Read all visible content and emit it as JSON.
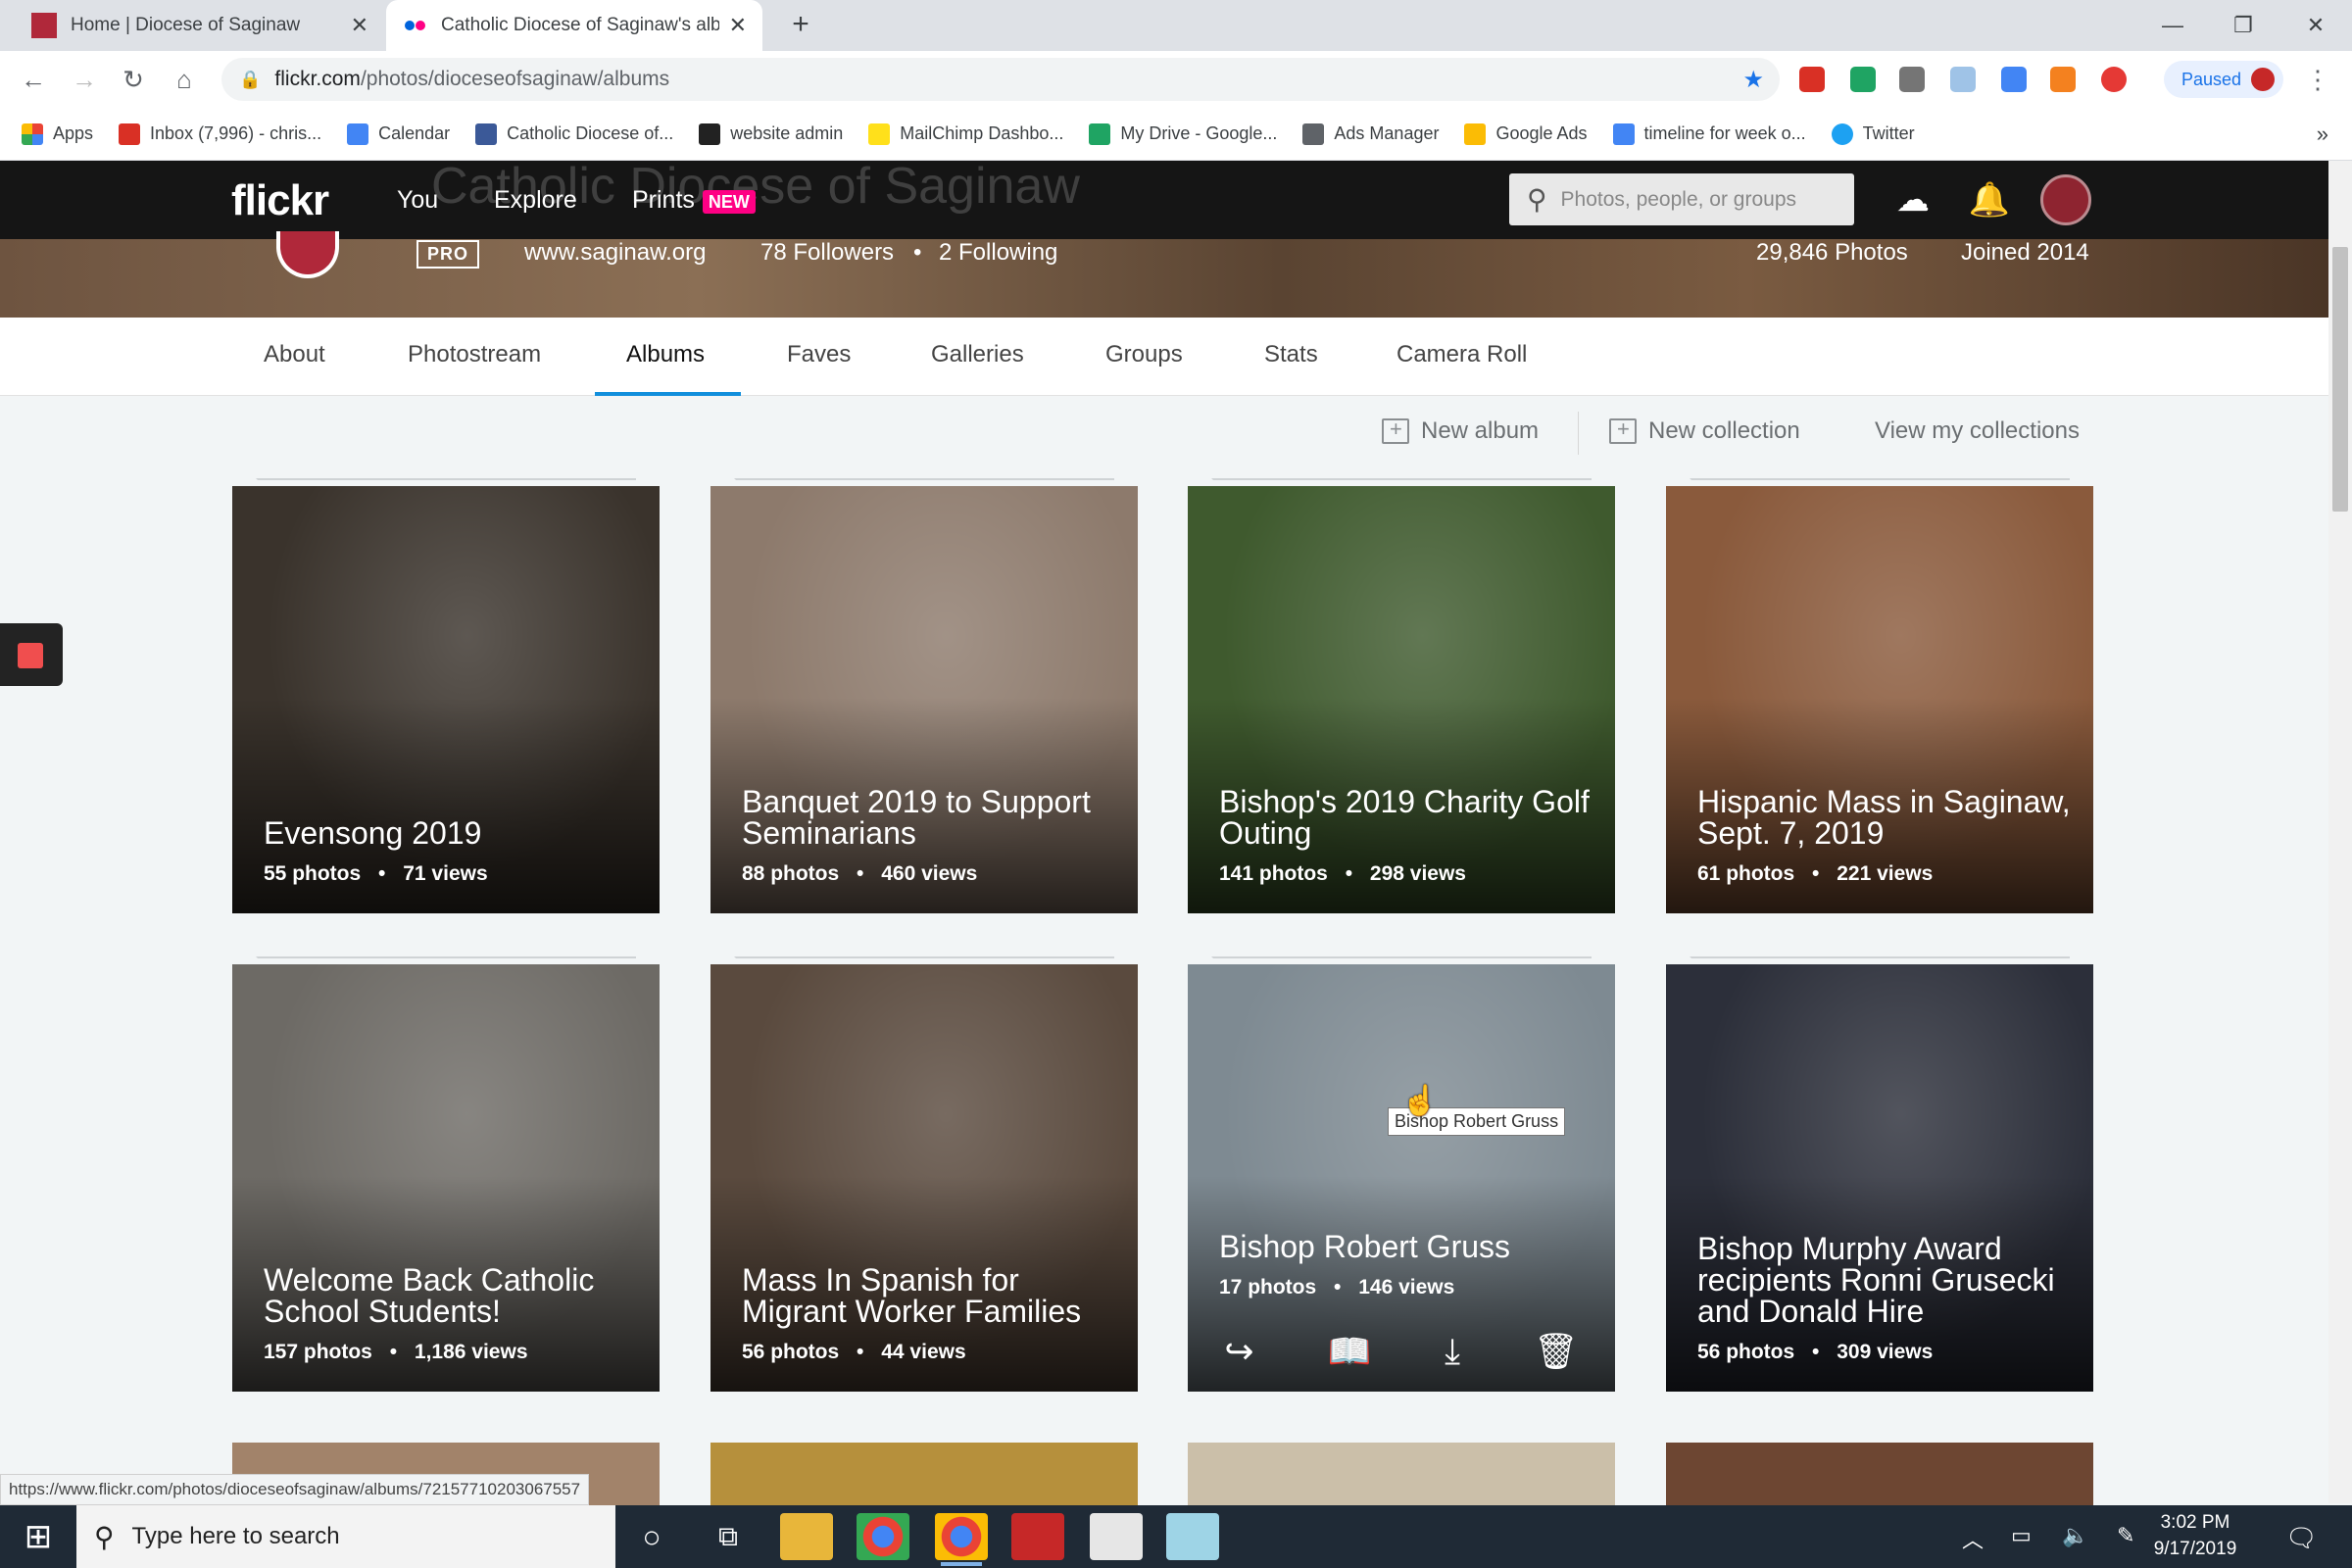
{
  "browser": {
    "tabs": [
      {
        "title": "Home | Diocese of Saginaw",
        "active": false
      },
      {
        "title": "Catholic Diocese of Saginaw's albums",
        "active": true
      }
    ],
    "new_tab": "+",
    "url_host": "flickr.com",
    "url_path": "/photos/dioceseofsaginaw/albums",
    "paused_label": "Paused",
    "bookmarks": [
      "Apps",
      "Inbox (7,996) - chris...",
      "Calendar",
      "Catholic Diocese of...",
      "website admin",
      "MailChimp Dashbo...",
      "My Drive - Google...",
      "Ads Manager",
      "Google Ads",
      "timeline for week o...",
      "Twitter"
    ],
    "more": "»"
  },
  "flickr": {
    "logo": "flickr",
    "nav": {
      "you": "You",
      "explore": "Explore",
      "prints": "Prints",
      "new_badge": "NEW"
    },
    "search_placeholder": "Photos, people, or groups",
    "cover_title": "Catholic Diocese of Saginaw",
    "pro": "PRO",
    "website": "www.saginaw.org",
    "followers": "78 Followers",
    "following": "2 Following",
    "dot": "•",
    "photos_count": "29,846 Photos",
    "joined": "Joined 2014",
    "subnav": [
      "About",
      "Photostream",
      "Albums",
      "Faves",
      "Galleries",
      "Groups",
      "Stats",
      "Camera Roll"
    ],
    "selected_subnav": "Albums",
    "actions": {
      "new_album": "New album",
      "new_collection": "New collection",
      "view_collections": "View my collections"
    },
    "albums": [
      {
        "title": "Evensong 2019",
        "photos": "55 photos",
        "views": "71 views",
        "bg": "#3a332c"
      },
      {
        "title": "Banquet 2019 to Support Seminarians",
        "photos": "88 photos",
        "views": "460 views",
        "bg": "#8d7a6c"
      },
      {
        "title": "Bishop's 2019 Charity Golf Outing",
        "photos": "141 photos",
        "views": "298 views",
        "bg": "#3f5a2e"
      },
      {
        "title": "Hispanic Mass in Saginaw, Sept. 7, 2019",
        "photos": "61 photos",
        "views": "221 views",
        "bg": "#8a5a3c"
      },
      {
        "title": "Welcome Back Catholic School Students!",
        "photos": "157 photos",
        "views": "1,186 views",
        "bg": "#6d6a65"
      },
      {
        "title": "Mass In Spanish for Migrant Worker Families",
        "photos": "56 photos",
        "views": "44 views",
        "bg": "#5a4a3e"
      },
      {
        "title": "Bishop Robert Gruss",
        "photos": "17 photos",
        "views": "146 views",
        "bg": "#7e8a92"
      },
      {
        "title": "Bishop Murphy Award recipients Ronni Grusecki and Donald Hire",
        "photos": "56 photos",
        "views": "309 views",
        "bg": "#2c2f3a"
      }
    ],
    "partial_album_colors": [
      "#a2836a",
      "#b6903c",
      "#cbbfa9",
      "#6d4632"
    ],
    "tooltip": "Bishop Robert Gruss"
  },
  "status_url": "https://www.flickr.com/photos/dioceseofsaginaw/albums/72157710203067557",
  "taskbar": {
    "search_placeholder": "Type here to search",
    "time": "3:02 PM",
    "date": "9/17/2019"
  }
}
